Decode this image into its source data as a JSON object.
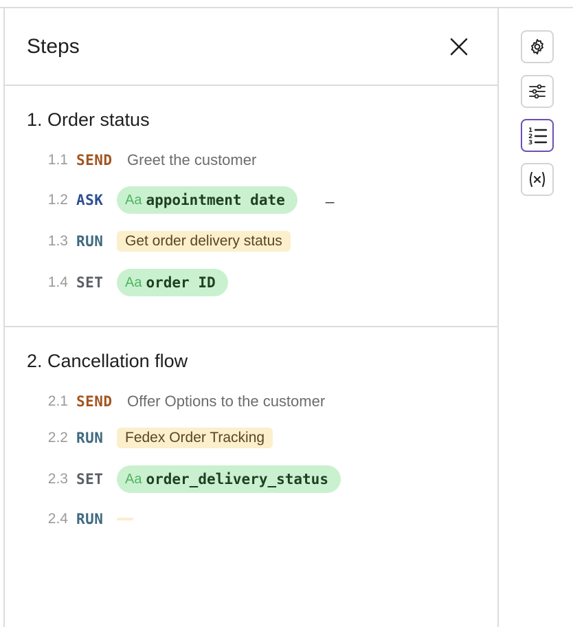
{
  "panel": {
    "title": "Steps"
  },
  "sections": [
    {
      "title": "1. Order status",
      "steps": [
        {
          "num": "1.1",
          "keyword": "SEND",
          "text": "Greet the customer"
        },
        {
          "num": "1.2",
          "keyword": "ASK",
          "var_prefix": "Aa",
          "var": "appointment date",
          "suffix": "_"
        },
        {
          "num": "1.3",
          "keyword": "RUN",
          "action": "Get order delivery status"
        },
        {
          "num": "1.4",
          "keyword": "SET",
          "var_prefix": "Aa",
          "var": "order ID"
        }
      ]
    },
    {
      "title": "2. Cancellation flow",
      "steps": [
        {
          "num": "2.1",
          "keyword": "SEND",
          "text": "Offer Options to the customer"
        },
        {
          "num": "2.2",
          "keyword": "RUN",
          "action": "Fedex Order Tracking"
        },
        {
          "num": "2.3",
          "keyword": "SET",
          "var_prefix": "Aa",
          "var": "order_delivery_status"
        },
        {
          "num": "2.4",
          "keyword": "RUN",
          "action": ""
        }
      ]
    }
  ],
  "toolbar": {
    "icons": [
      "gear-icon",
      "sliders-icon",
      "numbered-list-icon",
      "variable-icon"
    ],
    "active": "numbered-list-icon"
  },
  "colors": {
    "send": "#a2551f",
    "ask": "#2c4e93",
    "run": "#3f6a80",
    "set": "#5a5f66",
    "run_chip_bg": "#fbefcc",
    "var_chip_bg": "#c9f1cf",
    "active_border": "#6b4fb3"
  }
}
